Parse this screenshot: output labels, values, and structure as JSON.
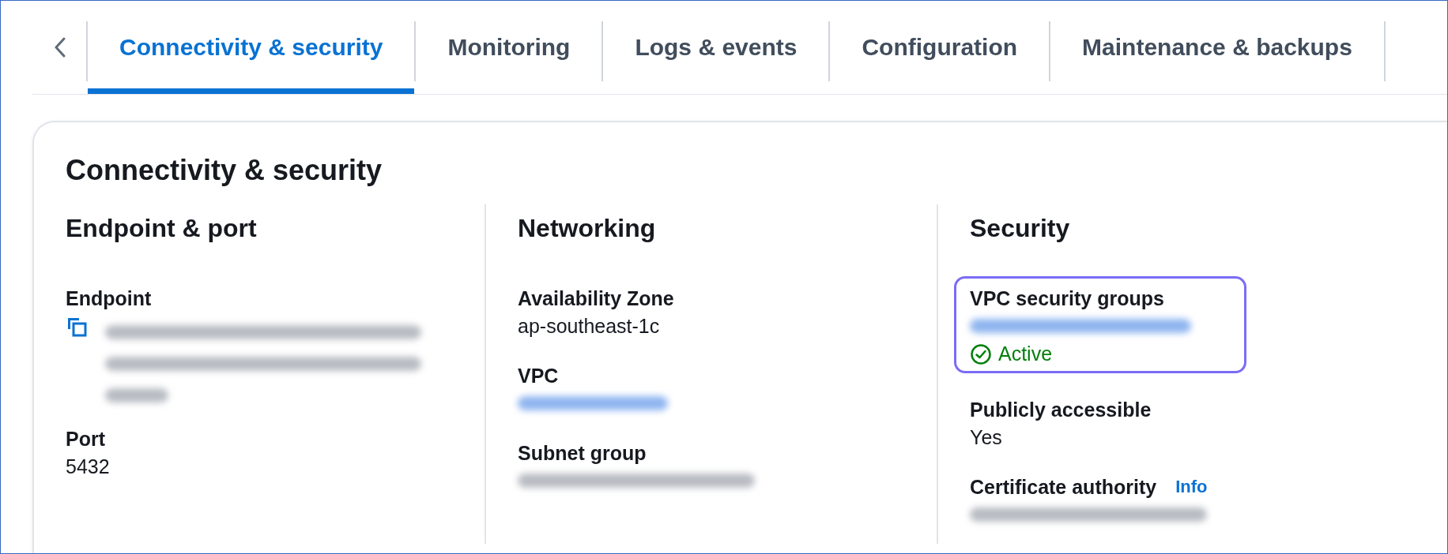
{
  "tabs": [
    {
      "label": "Connectivity & security",
      "selected": true
    },
    {
      "label": "Monitoring",
      "selected": false
    },
    {
      "label": "Logs & events",
      "selected": false
    },
    {
      "label": "Configuration",
      "selected": false
    },
    {
      "label": "Maintenance & backups",
      "selected": false
    }
  ],
  "panel": {
    "title": "Connectivity & security",
    "columns": [
      {
        "heading": "Endpoint & port",
        "fields": [
          {
            "label": "Endpoint",
            "kind": "redacted-multiline",
            "copy": true
          },
          {
            "label": "Port",
            "kind": "text",
            "value": "5432"
          }
        ]
      },
      {
        "heading": "Networking",
        "fields": [
          {
            "label": "Availability Zone",
            "kind": "text",
            "value": "ap-southeast-1c"
          },
          {
            "label": "VPC",
            "kind": "redacted-link"
          },
          {
            "label": "Subnet group",
            "kind": "redacted"
          }
        ]
      },
      {
        "heading": "Security",
        "fields": [
          {
            "label": "VPC security groups",
            "kind": "redacted-link",
            "status": "Active",
            "highlighted": true
          },
          {
            "label": "Publicly accessible",
            "kind": "text",
            "value": "Yes"
          },
          {
            "label": "Certificate authority",
            "info": "Info",
            "kind": "redacted"
          }
        ]
      }
    ]
  }
}
